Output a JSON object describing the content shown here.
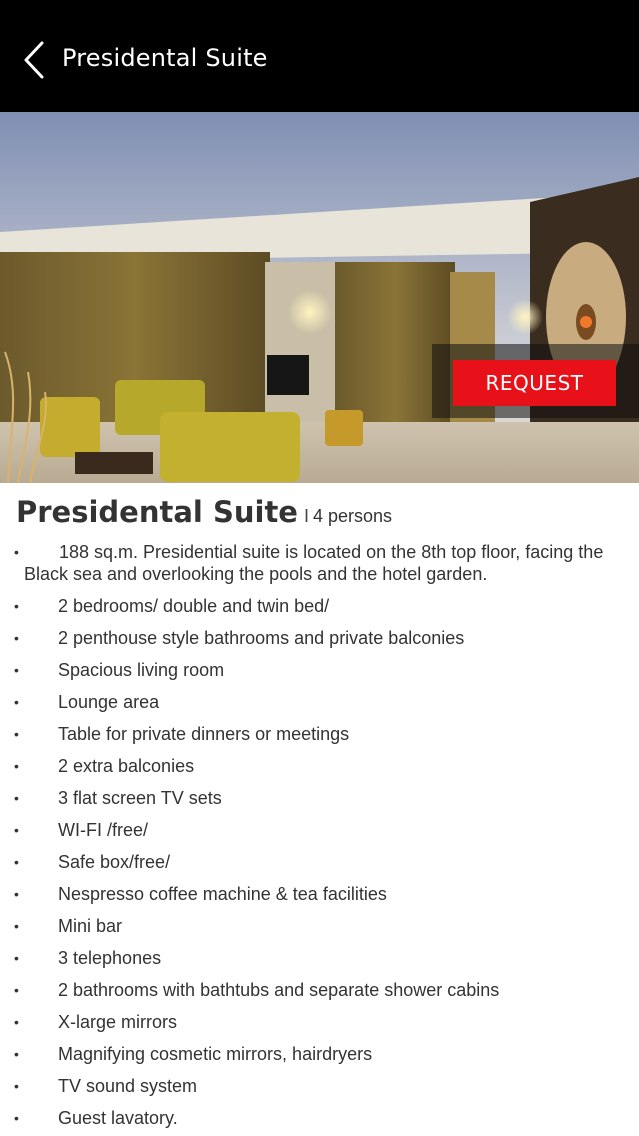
{
  "header": {
    "title": "Presidental Suite",
    "back_icon": "chevron-left-icon"
  },
  "hero": {
    "image_subject": "hotel suite living room",
    "request_label": "REQUEST",
    "request_color": "#e8111a"
  },
  "room": {
    "title": "Presidental Suite",
    "separator": "I",
    "capacity": "4 persons"
  },
  "features": [
    "188 sq.m. Presidential suite is located on the 8th top floor, facing the Black sea and overlooking the pools and the hotel garden.",
    "2 bedrooms/ double and twin bed/",
    "2 penthouse style bathrooms and private balconies",
    "Spacious living room",
    "Lounge area",
    "Table for private dinners or meetings",
    "2 extra balconies",
    "3 flat screen TV sets",
    "WI-FI /free/",
    "Safe box/free/",
    "Nespresso coffee machine & tea facilities",
    "Mini bar",
    "3 telephones",
    "2 bathrooms with bathtubs and separate shower cabins",
    "X-large mirrors",
    "Magnifying cosmetic mirrors, hairdryers",
    "TV sound system",
    "Guest lavatory."
  ],
  "bullet": "•"
}
